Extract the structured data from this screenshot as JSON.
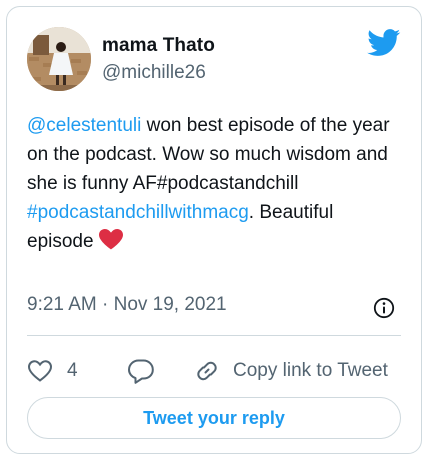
{
  "author": {
    "display_name": "mama Thato",
    "handle": "@michille26"
  },
  "tweet": {
    "mention": "@celestentuli",
    "text_part1": " won best episode of the year on the podcast. Wow so much wisdom and she is funny AF#podcastandchill ",
    "hashtag": "#podcastandchillwithmacg",
    "text_part2": ". Beautiful episode",
    "emoji": "red-heart"
  },
  "timestamp": "9:21 AM · Nov 19, 2021",
  "actions": {
    "like_count": "4",
    "copy_link_label": "Copy link to Tweet"
  },
  "reply_button_label": "Tweet your reply",
  "colors": {
    "accent": "#1d9bf0",
    "text": "#0f1419",
    "muted": "#536471",
    "border": "#cfd9de",
    "heart": "#f91880"
  },
  "icons": [
    "twitter-bird-icon",
    "info-icon",
    "heart-icon",
    "reply-icon",
    "link-icon"
  ]
}
